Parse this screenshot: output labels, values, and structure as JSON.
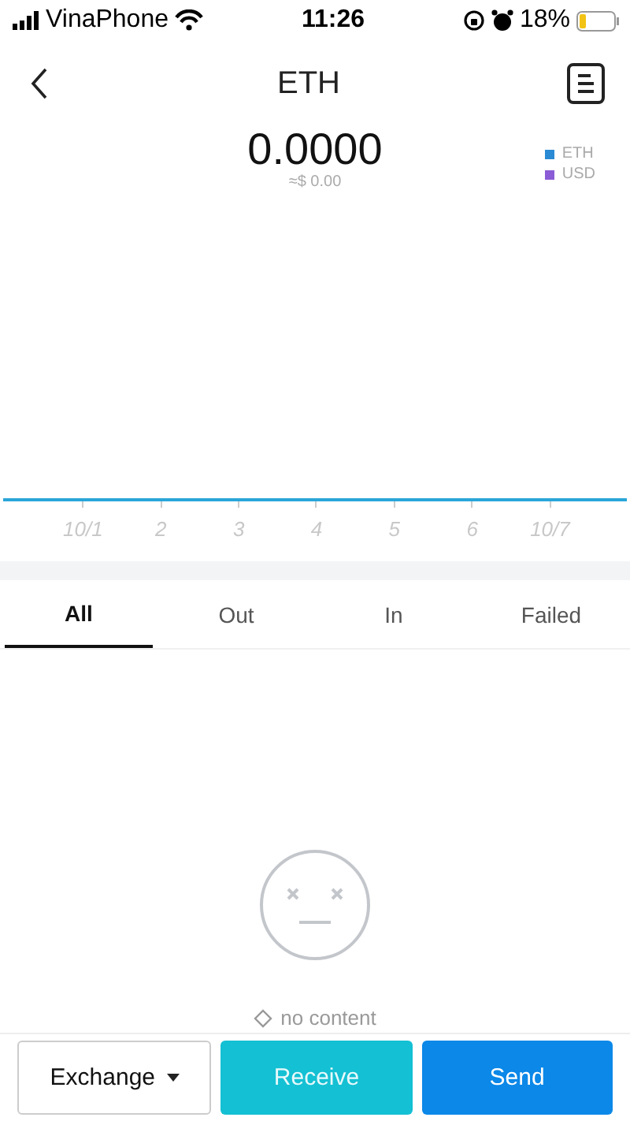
{
  "status_bar": {
    "carrier": "VinaPhone",
    "time": "11:26",
    "battery": "18%"
  },
  "nav": {
    "title": "ETH"
  },
  "balance": {
    "amount": "0.0000",
    "fiat": "≈$ 0.00"
  },
  "legend": [
    {
      "label": "ETH",
      "color": "#2a8ad4"
    },
    {
      "label": "USD",
      "color": "#8a5cd6"
    }
  ],
  "chart_x_labels": [
    "10/1",
    "2",
    "3",
    "4",
    "5",
    "6",
    "10/7"
  ],
  "tabs": [
    {
      "label": "All",
      "selected": true
    },
    {
      "label": "Out",
      "selected": false
    },
    {
      "label": "In",
      "selected": false
    },
    {
      "label": "Failed",
      "selected": false
    }
  ],
  "empty_state": {
    "message": "no content"
  },
  "actions": [
    {
      "label": "Exchange",
      "kind": "dropdown"
    },
    {
      "label": "Receive",
      "kind": "secondary"
    },
    {
      "label": "Send",
      "kind": "primary"
    }
  ]
}
